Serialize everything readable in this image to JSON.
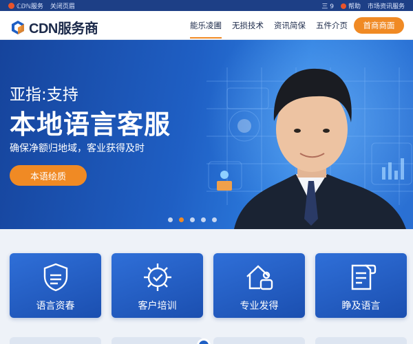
{
  "topbar": {
    "left_text": "ℂⅅℕ服务",
    "left_link": "关闭页眉",
    "right_num": "三 9",
    "right_link1": "帮助",
    "right_link2": "市场资讯服务"
  },
  "brand": {
    "name": "CDN服务商",
    "accent": "#1f5fc4"
  },
  "nav": {
    "items": [
      {
        "label": "能乐凌圃",
        "active": true
      },
      {
        "label": "无损技术",
        "active": false
      },
      {
        "label": "资讯简保",
        "active": false
      },
      {
        "label": "五件介页",
        "active": false
      }
    ],
    "cta_label": "首商商面"
  },
  "hero": {
    "subtitle": "亚指:支持",
    "title": "本地语言客服",
    "description": "确保净额归地域，客业获得及时",
    "button_label": "本语绘质",
    "slides": 5,
    "active_slide": 1
  },
  "cards": [
    {
      "label": "语言资春",
      "icon": "shield-icon"
    },
    {
      "label": "客户培训",
      "icon": "gear-check-icon"
    },
    {
      "label": "专业发得",
      "icon": "house-person-icon"
    },
    {
      "label": "睁及语言",
      "icon": "document-chat-icon"
    }
  ],
  "colors": {
    "primary": "#1f5fc4",
    "accent": "#f08a24",
    "dark_nav": "#1d3f86"
  }
}
